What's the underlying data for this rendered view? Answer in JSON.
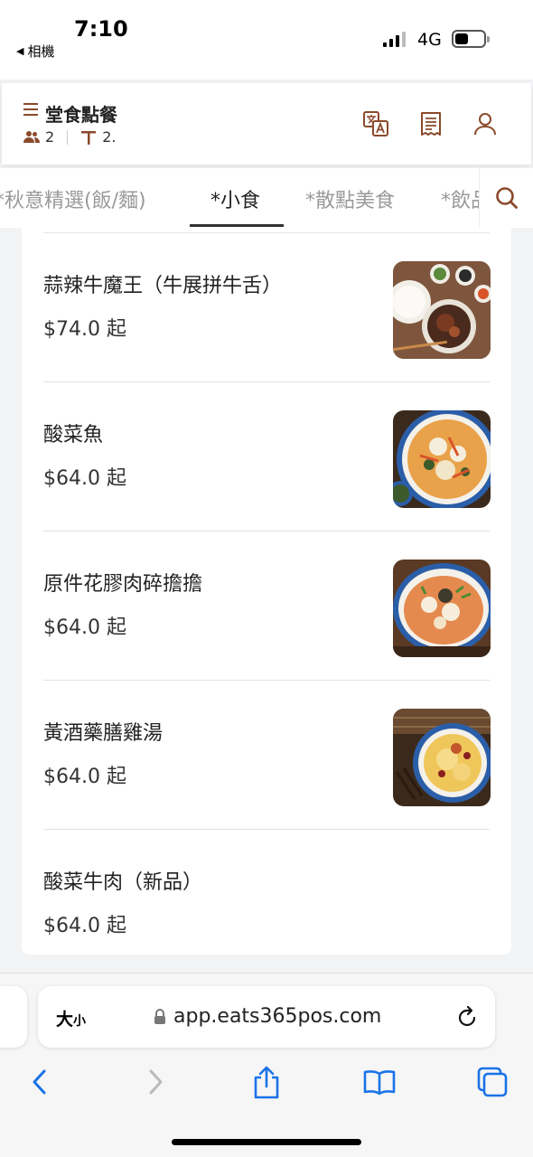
{
  "status_bar": {
    "time": "7:10",
    "back_app_label": "相機",
    "network": "4G",
    "battery_level": 0.45
  },
  "header": {
    "title": "堂食點餐",
    "guests": "2",
    "table": "2.",
    "icons": [
      "menu-icon",
      "translate-icon",
      "receipt-icon",
      "user-icon"
    ]
  },
  "tabs": [
    {
      "label": "*秋意精選(飯/麵)",
      "active": false
    },
    {
      "label": "*小食",
      "active": true
    },
    {
      "label": "*散點美食",
      "active": false
    },
    {
      "label": "*飲品",
      "active": false
    }
  ],
  "items": [
    {
      "name": "蒜辣牛魔王（牛展拼牛舌）",
      "price": "$74.0 起"
    },
    {
      "name": "酸菜魚",
      "price": "$64.0 起"
    },
    {
      "name": "原件花膠肉碎擔擔",
      "price": "$64.0 起"
    },
    {
      "name": "黃酒藥膳雞湯",
      "price": "$64.0 起"
    },
    {
      "name": "酸菜牛肉（新品）",
      "price": "$64.0 起"
    }
  ],
  "browser": {
    "text_size_label": "大",
    "text_size_small": "小",
    "url": "app.eats365pos.com"
  },
  "colors": {
    "accent": "#8b4a2b",
    "ios_blue": "#1a73e8"
  }
}
